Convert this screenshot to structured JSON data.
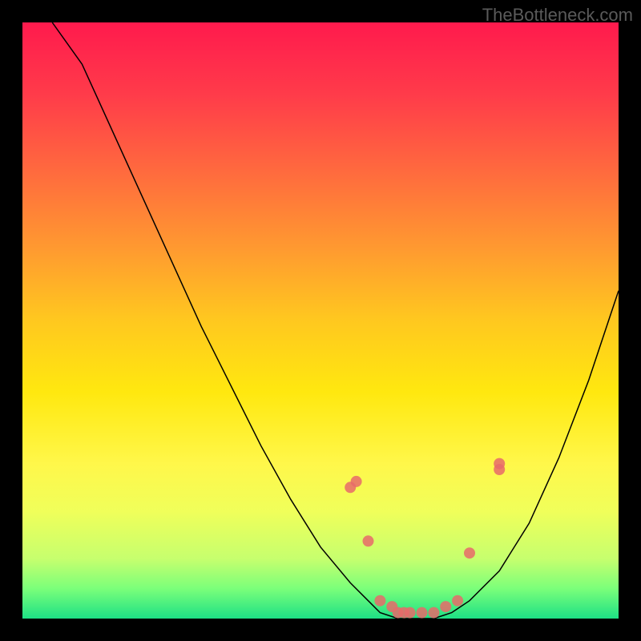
{
  "watermark": "TheBottleneck.com",
  "chart_data": {
    "type": "line",
    "title": "",
    "xlabel": "",
    "ylabel": "",
    "xlim": [
      0,
      100
    ],
    "ylim": [
      0,
      100
    ],
    "curve": {
      "x": [
        5,
        10,
        15,
        20,
        25,
        30,
        35,
        40,
        45,
        50,
        55,
        58,
        60,
        63,
        66,
        69,
        72,
        75,
        80,
        85,
        90,
        95,
        100
      ],
      "y": [
        100,
        93,
        82,
        71,
        60,
        49,
        39,
        29,
        20,
        12,
        6,
        3,
        1,
        0,
        0,
        0,
        1,
        3,
        8,
        16,
        27,
        40,
        55
      ]
    },
    "points": {
      "x": [
        55,
        56,
        58,
        60,
        62,
        63,
        64,
        65,
        67,
        69,
        71,
        73,
        75,
        80,
        80
      ],
      "y": [
        22,
        23,
        13,
        3,
        2,
        1,
        1,
        1,
        1,
        1,
        2,
        3,
        11,
        25,
        26
      ]
    }
  }
}
